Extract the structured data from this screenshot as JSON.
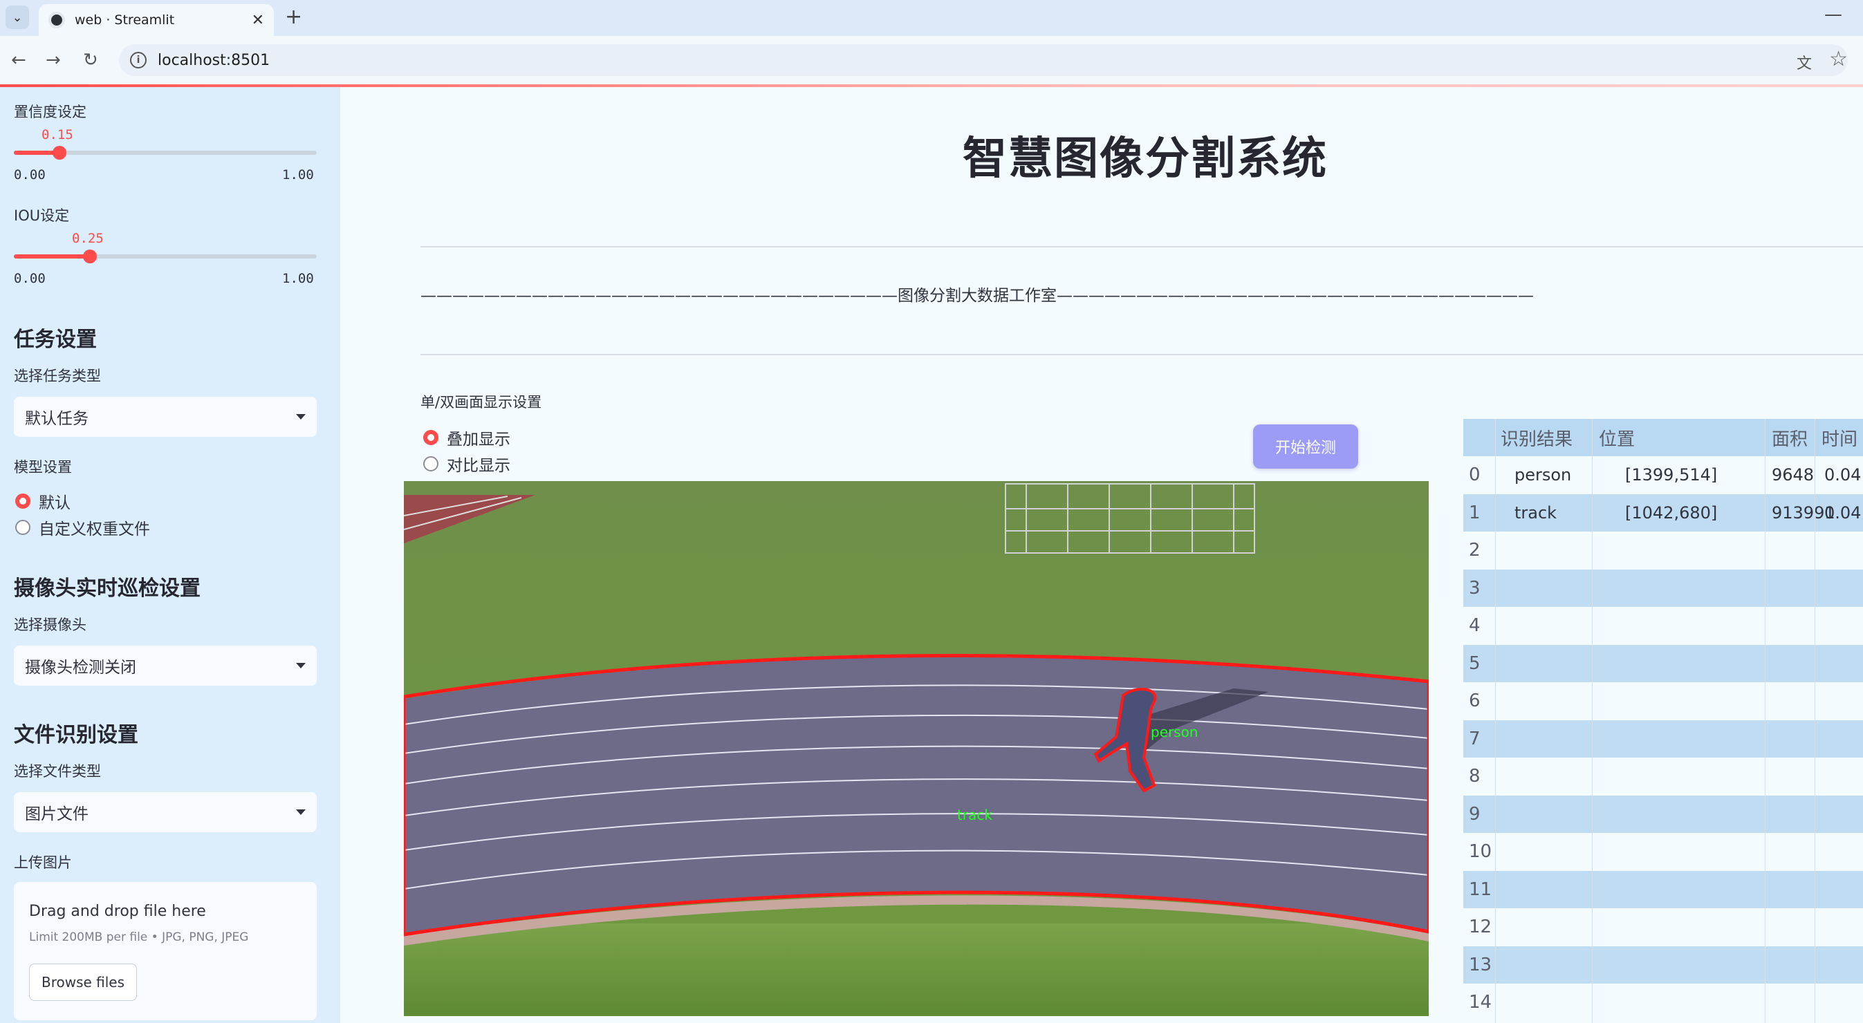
{
  "browser": {
    "tab_title": "web · Streamlit",
    "url": "localhost:8501"
  },
  "sidebar": {
    "confidence": {
      "label": "置信度设定",
      "value": "0.15",
      "min": "0.00",
      "max": "1.00",
      "fraction": 0.15
    },
    "iou": {
      "label": "IOU设定",
      "value": "0.25",
      "min": "0.00",
      "max": "1.00",
      "fraction": 0.25
    },
    "task_heading": "任务设置",
    "task_type_label": "选择任务类型",
    "task_type_value": "默认任务",
    "model_label": "模型设置",
    "model_options": [
      "默认",
      "自定义权重文件"
    ],
    "camera_heading": "摄像头实时巡检设置",
    "camera_label": "选择摄像头",
    "camera_value": "摄像头检测关闭",
    "file_heading": "文件识别设置",
    "file_type_label": "选择文件类型",
    "file_type_value": "图片文件",
    "upload_label": "上传图片",
    "upload_title": "Drag and drop file here",
    "upload_sub": "Limit 200MB per file • JPG, PNG, JPEG",
    "browse_label": "Browse files"
  },
  "main": {
    "title": "智慧图像分割系统",
    "divider": "——————————————————————————————图像分割大数据工作室——————————————————————————————",
    "display_label": "单/双画面显示设置",
    "display_options": [
      "叠加显示",
      "对比显示"
    ],
    "start_button": "开始检测",
    "scene_labels": {
      "person": "person",
      "track": "track"
    }
  },
  "table": {
    "headers": [
      "识别结果",
      "位置",
      "面积",
      "时间"
    ],
    "rows": [
      {
        "idx": "0",
        "result": "person",
        "pos": "[1399,514]",
        "area": "9648",
        "time": "0.04"
      },
      {
        "idx": "1",
        "result": "track",
        "pos": "[1042,680]",
        "area": "913991",
        "time": "0.04"
      },
      {
        "idx": "2",
        "result": "",
        "pos": "",
        "area": "",
        "time": ""
      },
      {
        "idx": "3",
        "result": "",
        "pos": "",
        "area": "",
        "time": ""
      },
      {
        "idx": "4",
        "result": "",
        "pos": "",
        "area": "",
        "time": ""
      },
      {
        "idx": "5",
        "result": "",
        "pos": "",
        "area": "",
        "time": ""
      },
      {
        "idx": "6",
        "result": "",
        "pos": "",
        "area": "",
        "time": ""
      },
      {
        "idx": "7",
        "result": "",
        "pos": "",
        "area": "",
        "time": ""
      },
      {
        "idx": "8",
        "result": "",
        "pos": "",
        "area": "",
        "time": ""
      },
      {
        "idx": "9",
        "result": "",
        "pos": "",
        "area": "",
        "time": ""
      },
      {
        "idx": "10",
        "result": "",
        "pos": "",
        "area": "",
        "time": ""
      },
      {
        "idx": "11",
        "result": "",
        "pos": "",
        "area": "",
        "time": ""
      },
      {
        "idx": "12",
        "result": "",
        "pos": "",
        "area": "",
        "time": ""
      },
      {
        "idx": "13",
        "result": "",
        "pos": "",
        "area": "",
        "time": ""
      },
      {
        "idx": "14",
        "result": "",
        "pos": "",
        "area": "",
        "time": ""
      }
    ]
  },
  "colors": {
    "accent": "#ff4b4b",
    "sidebar_bg": "#dceefb",
    "button": "#9c9cf7"
  }
}
